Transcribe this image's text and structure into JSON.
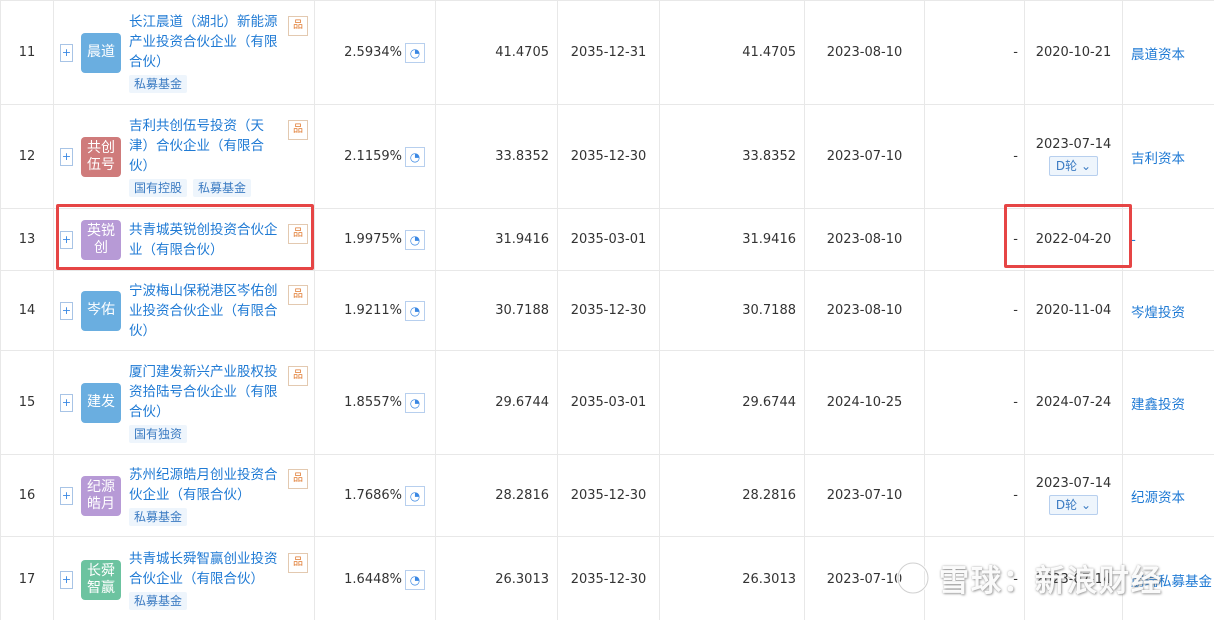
{
  "rows": [
    {
      "num": "11",
      "logo": "晨道",
      "logo_color": "#6aaee0",
      "name": "长江晨道（湖北）新能源产业投资合伙企业（有限合伙）",
      "tags": [
        "私募基金"
      ],
      "pct": "2.5934%",
      "amount": "41.4705",
      "date": "2035-12-31",
      "amount2": "41.4705",
      "date2": "2023-08-10",
      "dash": "-",
      "date3": "2020-10-21",
      "round": "",
      "org": "晨道资本"
    },
    {
      "num": "12",
      "logo": "共创伍号",
      "logo_color": "#cf7b7b",
      "name": "吉利共创伍号投资（天津）合伙企业（有限合伙）",
      "tags": [
        "国有控股",
        "私募基金"
      ],
      "pct": "2.1159%",
      "amount": "33.8352",
      "date": "2035-12-30",
      "amount2": "33.8352",
      "date2": "2023-07-10",
      "dash": "-",
      "date3": "2023-07-14",
      "round": "D轮",
      "org": "吉利资本"
    },
    {
      "num": "13",
      "logo": "英锐创",
      "logo_color": "#b79ad6",
      "name": "共青城英锐创投资合伙企业（有限合伙）",
      "tags": [],
      "pct": "1.9975%",
      "amount": "31.9416",
      "date": "2035-03-01",
      "amount2": "31.9416",
      "date2": "2023-08-10",
      "dash": "-",
      "date3": "2022-04-20",
      "round": "",
      "org": "-"
    },
    {
      "num": "14",
      "logo": "岑佑",
      "logo_color": "#6aaee0",
      "name": "宁波梅山保税港区岑佑创业投资合伙企业（有限合伙）",
      "tags": [],
      "pct": "1.9211%",
      "amount": "30.7188",
      "date": "2035-12-30",
      "amount2": "30.7188",
      "date2": "2023-08-10",
      "dash": "-",
      "date3": "2020-11-04",
      "round": "",
      "org": "岑煌投资"
    },
    {
      "num": "15",
      "logo": "建发",
      "logo_color": "#6aaee0",
      "name": "厦门建发新兴产业股权投资拾陆号合伙企业（有限合伙）",
      "tags": [
        "国有独资"
      ],
      "pct": "1.8557%",
      "amount": "29.6744",
      "date": "2035-03-01",
      "amount2": "29.6744",
      "date2": "2024-10-25",
      "dash": "-",
      "date3": "2024-07-24",
      "round": "",
      "org": "建鑫投资"
    },
    {
      "num": "16",
      "logo": "纪源皓月",
      "logo_color": "#b79ad6",
      "name": "苏州纪源皓月创业投资合伙企业（有限合伙）",
      "tags": [
        "私募基金"
      ],
      "pct": "1.7686%",
      "amount": "28.2816",
      "date": "2035-12-30",
      "amount2": "28.2816",
      "date2": "2023-07-10",
      "dash": "-",
      "date3": "2023-07-14",
      "round": "D轮",
      "org": "纪源资本"
    },
    {
      "num": "17",
      "logo": "长舜智赢",
      "logo_color": "#6cc3a0",
      "name": "共青城长舜智赢创业投资合伙企业（有限合伙）",
      "tags": [
        "私募基金"
      ],
      "pct": "1.6448%",
      "amount": "26.3013",
      "date": "2035-12-30",
      "amount2": "26.3013",
      "date2": "2023-07-10",
      "dash": "-",
      "date3": "2023-07-14",
      "round": "",
      "org": "朋瑞私募基金"
    }
  ],
  "icons": {
    "expand": "+",
    "tree": "品",
    "pie": "◔",
    "round_caret": "⌄"
  },
  "watermark": {
    "text": "雪球：新浪财经"
  },
  "colors": {
    "link": "#1f7ad4",
    "highlight": "#e64545",
    "tree_icon": "#e07a30"
  }
}
